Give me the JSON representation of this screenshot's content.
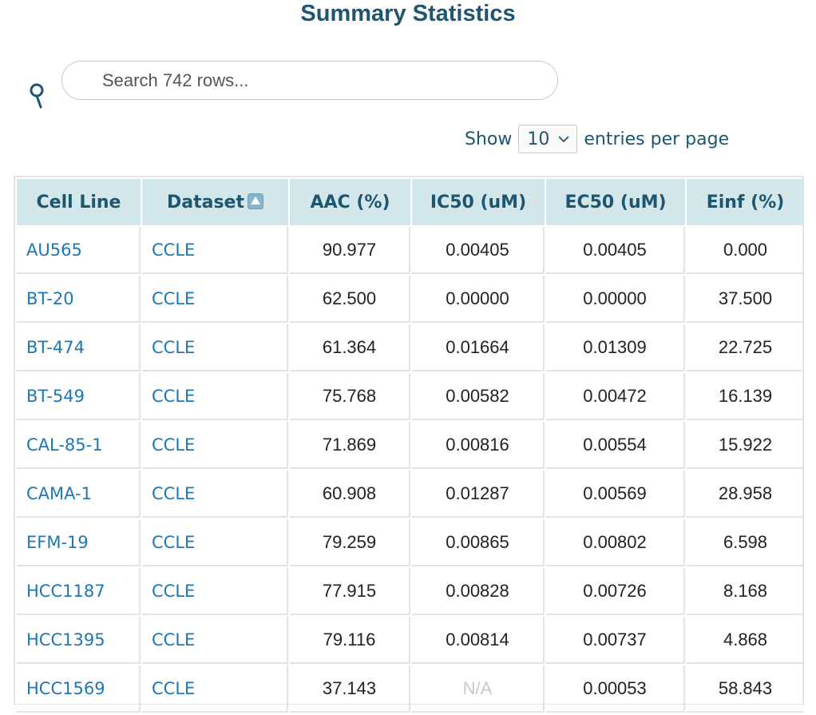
{
  "title": "Summary Statistics",
  "search": {
    "placeholder": "Search 742 rows..."
  },
  "pagination": {
    "show_label": "Show",
    "page_size": "10",
    "suffix_label": "entries per page"
  },
  "table": {
    "columns": [
      "Cell Line",
      "Dataset",
      "AAC (%)",
      "IC50 (uM)",
      "EC50 (uM)",
      "Einf (%)"
    ],
    "sorted_column": "Dataset",
    "rows": [
      [
        "AU565",
        "CCLE",
        "90.977",
        "0.00405",
        "0.00405",
        "0.000"
      ],
      [
        "BT-20",
        "CCLE",
        "62.500",
        "0.00000",
        "0.00000",
        "37.500"
      ],
      [
        "BT-474",
        "CCLE",
        "61.364",
        "0.01664",
        "0.01309",
        "22.725"
      ],
      [
        "BT-549",
        "CCLE",
        "75.768",
        "0.00582",
        "0.00472",
        "16.139"
      ],
      [
        "CAL-85-1",
        "CCLE",
        "71.869",
        "0.00816",
        "0.00554",
        "15.922"
      ],
      [
        "CAMA-1",
        "CCLE",
        "60.908",
        "0.01287",
        "0.00569",
        "28.958"
      ],
      [
        "EFM-19",
        "CCLE",
        "79.259",
        "0.00865",
        "0.00802",
        "6.598"
      ],
      [
        "HCC1187",
        "CCLE",
        "77.915",
        "0.00828",
        "0.00726",
        "8.168"
      ],
      [
        "HCC1395",
        "CCLE",
        "79.116",
        "0.00814",
        "0.00737",
        "4.868"
      ],
      [
        "HCC1569",
        "CCLE",
        "37.143",
        "N/A",
        "0.00053",
        "58.843"
      ]
    ]
  },
  "colors": {
    "title": "#1d5671",
    "header_bg": "#d3e6ea",
    "link": "#1d77b3",
    "na_text": "#c8c8c8"
  }
}
